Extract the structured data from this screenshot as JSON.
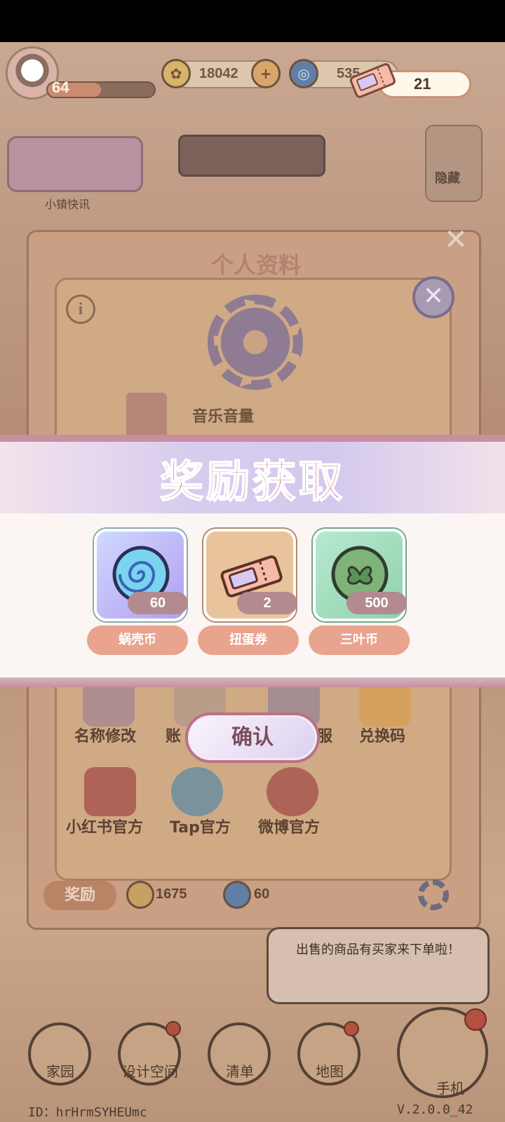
{
  "hud": {
    "level": "64",
    "gold_coins": "18042",
    "spiral_coins": "535",
    "gacha_tickets": "21"
  },
  "background": {
    "news_label": "小镇快讯",
    "hide_label": "隐藏"
  },
  "profile_panel": {
    "title": "个人资料",
    "music_volume_label": "音乐音量",
    "features": [
      {
        "label": "名称修改",
        "icon": "pencil-icon"
      },
      {
        "label": "账",
        "icon": "account-icon"
      },
      {
        "label": "服",
        "icon": "headset-icon"
      },
      {
        "label": "兑换码",
        "icon": "ticket-icon"
      },
      {
        "label": "小红书官方",
        "icon": "book-icon"
      },
      {
        "label": "Tap官方",
        "icon": "tap-icon"
      },
      {
        "label": "微博官方",
        "icon": "weibo-icon"
      }
    ],
    "tab_reward": "奖励",
    "reward_gold": "1675",
    "reward_spiral": "60",
    "speech_text": "出售的商品有买家来下单啦！"
  },
  "bottom_nav": [
    {
      "label": "家园",
      "icon": "home-icon"
    },
    {
      "label": "设计空间",
      "icon": "design-icon"
    },
    {
      "label": "清单",
      "icon": "list-icon"
    },
    {
      "label": "地图",
      "icon": "map-pin-icon"
    }
  ],
  "phone_label": "手机",
  "footer": {
    "user_id": "ID：hrHrmSYHEUmc",
    "version": "V.2.0.0_42"
  },
  "modal": {
    "title": "奖励获取",
    "rewards": [
      {
        "label": "蜗壳币",
        "count": "60",
        "icon": "spiral-coin-icon"
      },
      {
        "label": "扭蛋券",
        "count": "2",
        "icon": "gacha-ticket-icon"
      },
      {
        "label": "三叶币",
        "count": "500",
        "icon": "clover-coin-icon"
      }
    ],
    "confirm_label": "确认"
  },
  "colors": {
    "modal_title": "#c25877",
    "reward_label_bg": "#e8a48e",
    "confirm_border": "#b8728a"
  }
}
